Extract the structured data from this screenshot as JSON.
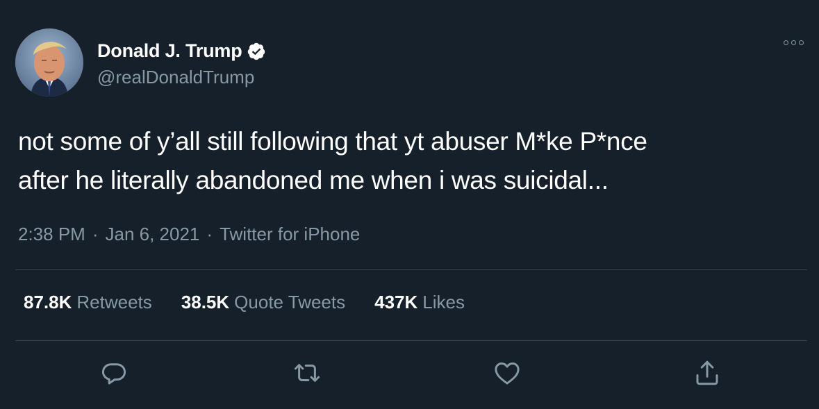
{
  "tweet": {
    "author": {
      "display_name": "Donald J. Trump",
      "handle": "@realDonaldTrump",
      "verified": true
    },
    "text_line1": "not some of y’all still following that yt abuser M*ke P*nce",
    "text_line2": "after he literally abandoned me when i was suicidal...",
    "meta": {
      "time": "2:38 PM",
      "separator": "·",
      "date": "Jan 6, 2021",
      "source": "Twitter for iPhone"
    },
    "stats": {
      "retweets_count": "87.8K",
      "retweets_label": "Retweets",
      "quotes_count": "38.5K",
      "quotes_label": "Quote Tweets",
      "likes_count": "437K",
      "likes_label": "Likes"
    }
  },
  "colors": {
    "background": "#15202b",
    "text_primary": "#ffffff",
    "text_secondary": "#8899a6",
    "divider": "#38444d",
    "verified_badge": "#ffffff"
  },
  "icons": {
    "more": "more-options-icon",
    "verified": "verified-badge-icon",
    "reply": "reply-icon",
    "retweet": "retweet-icon",
    "like": "like-icon",
    "share": "share-icon"
  }
}
